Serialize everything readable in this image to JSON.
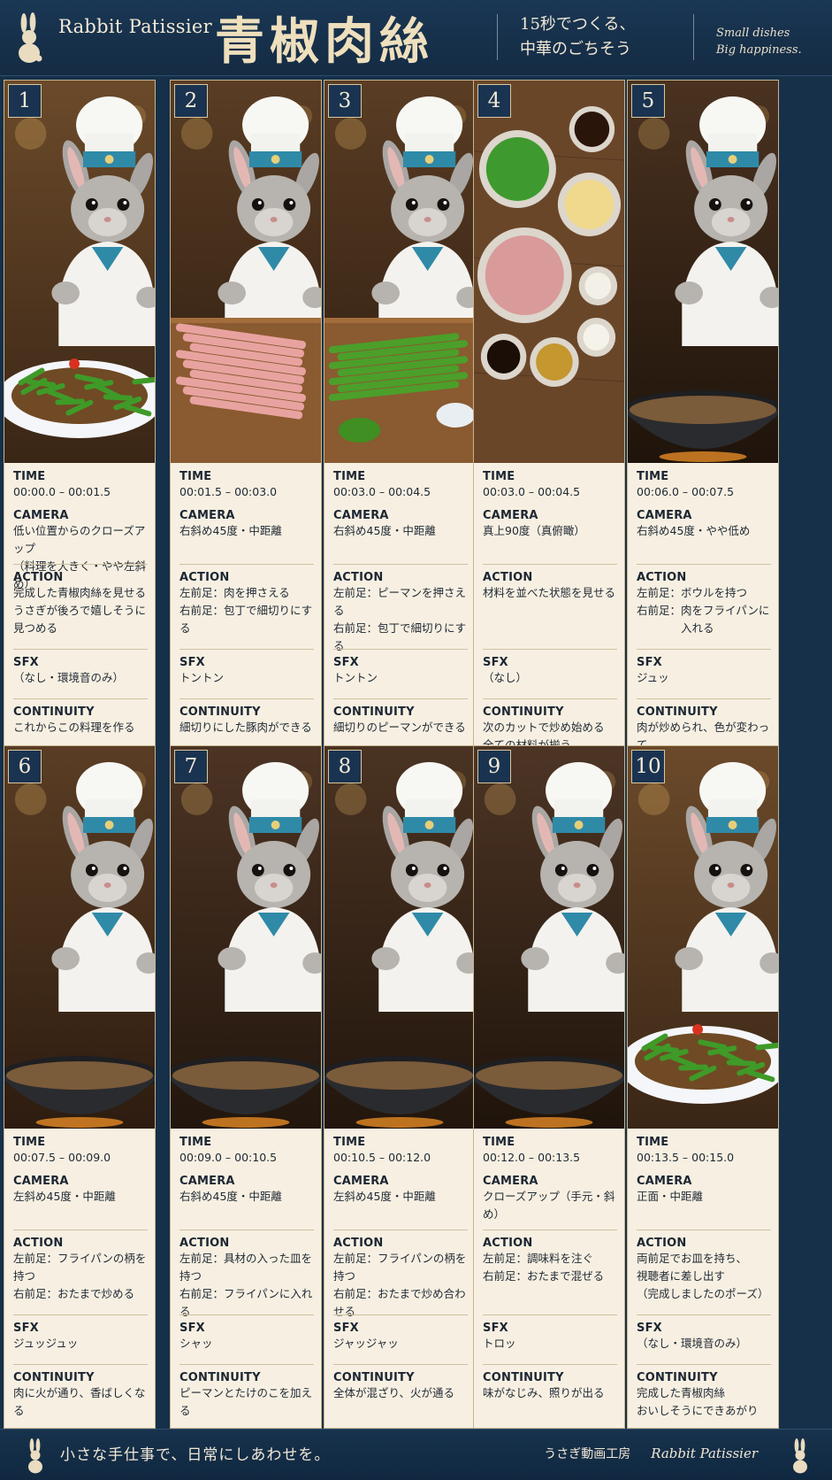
{
  "header": {
    "brand": "Rabbit Patissier",
    "title": "青椒肉絲",
    "subtitle_line1": "15秒でつくる、",
    "subtitle_line2": "中華のごちそう",
    "tagline_line1": "Small dishes",
    "tagline_line2": "Big happiness."
  },
  "labels": {
    "time": "TIME",
    "camera": "CAMERA",
    "action": "ACTION",
    "sfx": "SFX",
    "continuity": "CONTINUITY"
  },
  "panels": [
    {
      "number": "1",
      "scene": "finished-dish-closeup",
      "time": "00:00.0 – 00:01.5",
      "camera": "低い位置からのクローズアップ\n（料理を大きく・やや左斜め）",
      "action": "完成した青椒肉絲を見せる\nうさぎが後ろで嬉しそうに\n見つめる",
      "sfx": "（なし・環境音のみ）",
      "continuity": "これからこの料理を作る"
    },
    {
      "number": "2",
      "scene": "cutting-pork",
      "time": "00:01.5 – 00:03.0",
      "camera": "右斜め45度・中距離",
      "action": "左前足：肉を押さえる\n右前足：包丁で細切りにする",
      "sfx": "トントン",
      "continuity": "細切りにした豚肉ができる"
    },
    {
      "number": "3",
      "scene": "cutting-peppers",
      "time": "00:03.0 – 00:04.5",
      "camera": "右斜め45度・中距離",
      "action": "左前足：ピーマンを押さえる\n右前足：包丁で細切りにする",
      "sfx": "トントン",
      "continuity": "細切りのピーマンができる"
    },
    {
      "number": "4",
      "scene": "ingredients-overhead",
      "time": "00:03.0 – 00:04.5",
      "camera": "真上90度（真俯瞰）",
      "action": "材料を並べた状態を見せる",
      "sfx": "（なし）",
      "continuity": "次のカットで炒め始める\n全ての材料が揃う"
    },
    {
      "number": "5",
      "scene": "adding-meat-to-wok",
      "time": "00:06.0 – 00:07.5",
      "camera": "右斜め45度・やや低め",
      "action": "左前足：ボウルを持つ\n右前足：肉をフライパンに\n　　　　入れる",
      "sfx": "ジュッ",
      "continuity": "肉が炒められ、色が変わって\nいく"
    },
    {
      "number": "6",
      "scene": "stirring-meat",
      "time": "00:07.5 – 00:09.0",
      "camera": "左斜め45度・中距離",
      "action": "左前足：フライパンの柄を持つ\n右前足：おたまで炒める",
      "sfx": "ジュッジュッ",
      "continuity": "肉に火が通り、香ばしくなる"
    },
    {
      "number": "7",
      "scene": "adding-vegetables",
      "time": "00:09.0 – 00:10.5",
      "camera": "右斜め45度・中距離",
      "action": "左前足：具材の入った皿を持つ\n右前足：フライパンに入れる",
      "sfx": "シャッ",
      "continuity": "ピーマンとたけのこを加える"
    },
    {
      "number": "8",
      "scene": "mixing-in-wok",
      "time": "00:10.5 – 00:12.0",
      "camera": "左斜め45度・中距離",
      "action": "左前足：フライパンの柄を持つ\n右前足：おたまで炒め合わせる",
      "sfx": "ジャッジャッ",
      "continuity": "全体が混ざり、火が通る"
    },
    {
      "number": "9",
      "scene": "pouring-sauce",
      "time": "00:12.0 – 00:13.5",
      "camera": "クローズアップ（手元・斜め）",
      "action": "左前足：調味料を注ぐ\n右前足：おたまで混ぜる",
      "sfx": "トロッ",
      "continuity": "味がなじみ、照りが出る"
    },
    {
      "number": "10",
      "scene": "presenting-plate",
      "time": "00:13.5 – 00:15.0",
      "camera": "正面・中距離",
      "action": "両前足でお皿を持ち、\n視聴者に差し出す\n（完成しましたのポーズ）",
      "sfx": "（なし・環境音のみ）",
      "continuity": "完成した青椒肉絲\nおいしそうにできあがり"
    }
  ],
  "footer": {
    "motto": "小さな手仕事で、日常にしあわせを。",
    "studio_jp": "うさぎ動画工房",
    "studio_en": "Rabbit Patissier"
  },
  "colors": {
    "navy": "#16304a",
    "cream": "#f7f0e2",
    "gold": "#e8d7af"
  }
}
